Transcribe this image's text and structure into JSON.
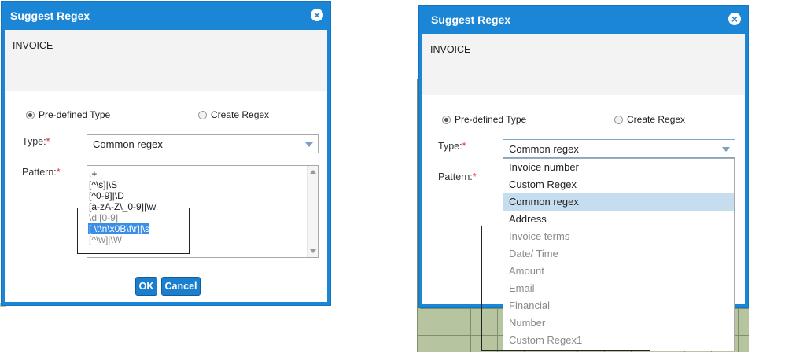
{
  "left_dialog": {
    "title": "Suggest Regex",
    "document_text": "INVOICE",
    "radio_predefined": "Pre-defined Type",
    "radio_create": "Create Regex",
    "type_label": "Type:",
    "type_required": "*",
    "type_value": "Common regex",
    "pattern_label": "Pattern:",
    "pattern_required": "*",
    "patterns": [
      ".+",
      "[^\\s]|\\S",
      "[^0-9]|\\D",
      "[a-zA-Z\\_0-9]|\\w",
      "\\d|[0-9]",
      "[ \\t\\n\\x0B\\f\\r]|\\s",
      "[^\\w]|\\W"
    ],
    "ok_label": "OK",
    "cancel_label": "Cancel"
  },
  "right_dialog": {
    "title": "Suggest Regex",
    "document_text": "INVOICE",
    "radio_predefined": "Pre-defined Type",
    "radio_create": "Create Regex",
    "type_label": "Type:",
    "type_required": "*",
    "type_value": "Common regex",
    "pattern_label": "Pattern:",
    "pattern_required": "*",
    "options": [
      "Invoice number",
      "Custom Regex",
      "Common regex",
      "Address",
      "Invoice terms",
      "Date/ Time",
      "Amount",
      "Email",
      "Financial",
      "Number",
      "Custom Regex1"
    ]
  },
  "colors": {
    "dialog_blue": "#1c86d6",
    "selection_blue": "#3a8ee6",
    "option_highlight": "#c6ddf0",
    "required_red": "#d22222"
  }
}
